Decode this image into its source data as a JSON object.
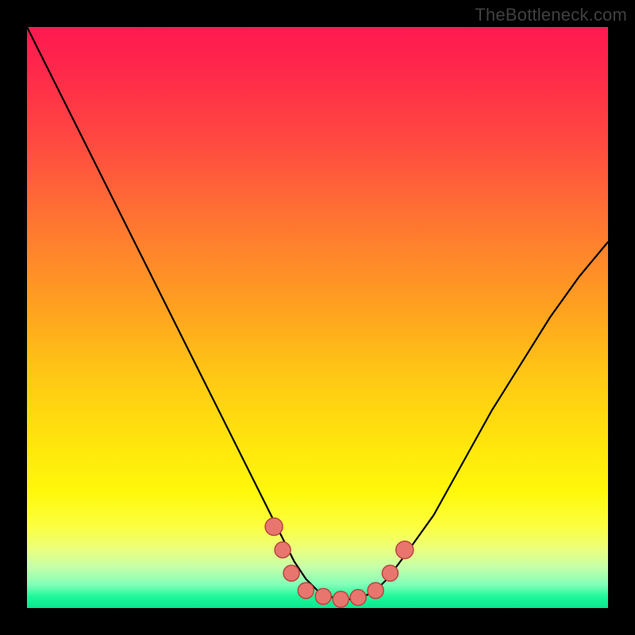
{
  "watermark": "TheBottleneck.com",
  "chart_data": {
    "type": "line",
    "title": "",
    "xlabel": "",
    "ylabel": "",
    "xlim": [
      0,
      100
    ],
    "ylim": [
      0,
      100
    ],
    "series": [
      {
        "name": "curve",
        "x": [
          0,
          5,
          10,
          15,
          20,
          25,
          30,
          35,
          40,
          42,
          44,
          46,
          48,
          50,
          52,
          54,
          56,
          58,
          60,
          62,
          65,
          70,
          75,
          80,
          85,
          90,
          95,
          100
        ],
        "values": [
          100,
          90,
          80,
          70,
          60,
          50,
          40,
          30,
          20,
          16,
          12,
          8,
          5,
          3,
          2,
          1.5,
          1.5,
          2,
          3,
          5,
          9,
          16,
          25,
          34,
          42,
          50,
          57,
          63
        ]
      }
    ],
    "markers": [
      {
        "x": 42.5,
        "y": 14,
        "size": 11
      },
      {
        "x": 44,
        "y": 10,
        "size": 10
      },
      {
        "x": 45.5,
        "y": 6,
        "size": 10
      },
      {
        "x": 48,
        "y": 3,
        "size": 10
      },
      {
        "x": 51,
        "y": 2,
        "size": 10
      },
      {
        "x": 54,
        "y": 1.5,
        "size": 10
      },
      {
        "x": 57,
        "y": 1.8,
        "size": 10
      },
      {
        "x": 60,
        "y": 3,
        "size": 10
      },
      {
        "x": 62.5,
        "y": 6,
        "size": 10
      },
      {
        "x": 65,
        "y": 10,
        "size": 11
      }
    ],
    "colors": {
      "curve_stroke": "#000000",
      "marker_fill": "#e8766e",
      "marker_stroke": "#b7453f"
    }
  }
}
